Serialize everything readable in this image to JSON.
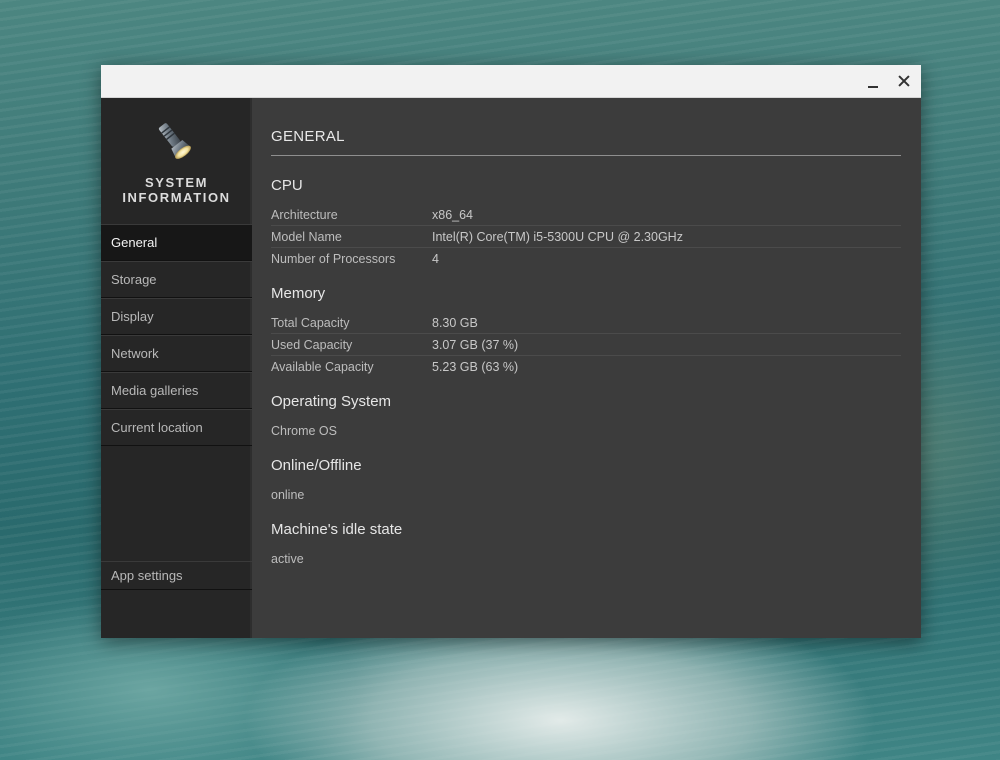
{
  "window": {
    "controls": {
      "minimize_icon": "minimize-icon",
      "close_icon": "close-icon"
    }
  },
  "sidebar": {
    "logo_icon": "flashlight-icon",
    "app_title_line1": "SYSTEM",
    "app_title_line2": "INFORMATION",
    "items": [
      {
        "label": "General",
        "active": true
      },
      {
        "label": "Storage",
        "active": false
      },
      {
        "label": "Display",
        "active": false
      },
      {
        "label": "Network",
        "active": false
      },
      {
        "label": "Media galleries",
        "active": false
      },
      {
        "label": "Current location",
        "active": false
      }
    ],
    "settings_label": "App settings"
  },
  "main": {
    "title": "GENERAL",
    "cpu": {
      "heading": "CPU",
      "rows": [
        {
          "key": "Architecture",
          "value": "x86_64"
        },
        {
          "key": "Model Name",
          "value": "Intel(R) Core(TM) i5-5300U CPU @ 2.30GHz"
        },
        {
          "key": "Number of Processors",
          "value": "4"
        }
      ]
    },
    "memory": {
      "heading": "Memory",
      "rows": [
        {
          "key": "Total Capacity",
          "value": "8.30 GB"
        },
        {
          "key": "Used Capacity",
          "value": "3.07 GB (37 %)"
        },
        {
          "key": "Available Capacity",
          "value": "5.23 GB (63 %)"
        }
      ]
    },
    "os": {
      "heading": "Operating System",
      "value": "Chrome OS"
    },
    "online": {
      "heading": "Online/Offline",
      "value": "online"
    },
    "idle": {
      "heading": "Machine's idle state",
      "value": "active"
    }
  },
  "colors": {
    "sidebar_bg": "#262626",
    "content_bg": "#3c3c3c",
    "titlebar_bg": "#f2f2f2"
  }
}
